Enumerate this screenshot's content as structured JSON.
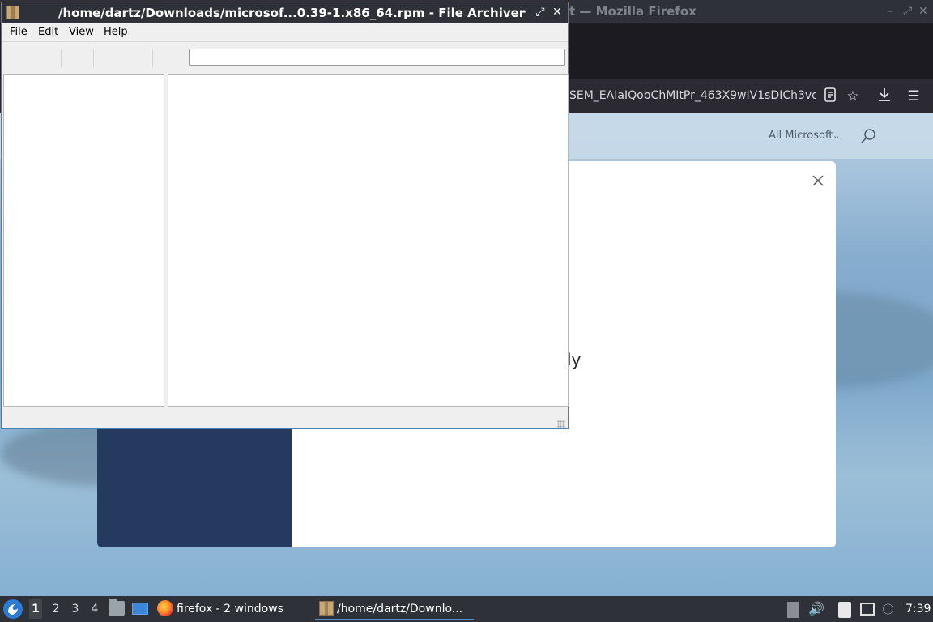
{
  "firefox": {
    "title": "t — Mozilla Firefox",
    "url": "SEM_EAIaIQobChMItPr_463X9wIV1sDICh3vd",
    "header_all_microsoft": "All Microsoft",
    "modal_text_fragment": "ly"
  },
  "archiver": {
    "title": "/home/dartz/Downloads/microsof...0.39-1.x86_64.rpm - File Archiver",
    "menu": {
      "file": "File",
      "edit": "Edit",
      "view": "View",
      "help": "Help"
    },
    "location_value": ""
  },
  "taskbar": {
    "workspaces": [
      "1",
      "2",
      "3",
      "4"
    ],
    "active_workspace": "1",
    "firefox_task": "firefox - 2 windows",
    "archiver_task": "/home/dartz/Downlo...",
    "clock": "7:39"
  },
  "icons": {
    "start": "distro-logo-icon",
    "files": "file-manager-icon",
    "desktop": "show-desktop-icon",
    "firefox": "firefox-icon",
    "archive": "archive-icon",
    "volume": "volume-icon",
    "clipboard": "clipboard-icon",
    "network": "network-icon",
    "notification": "notification-icon"
  },
  "colors": {
    "panel": "#2e3238",
    "accent": "#4a7fb5",
    "ms_dark_blue": "#243a5e"
  }
}
